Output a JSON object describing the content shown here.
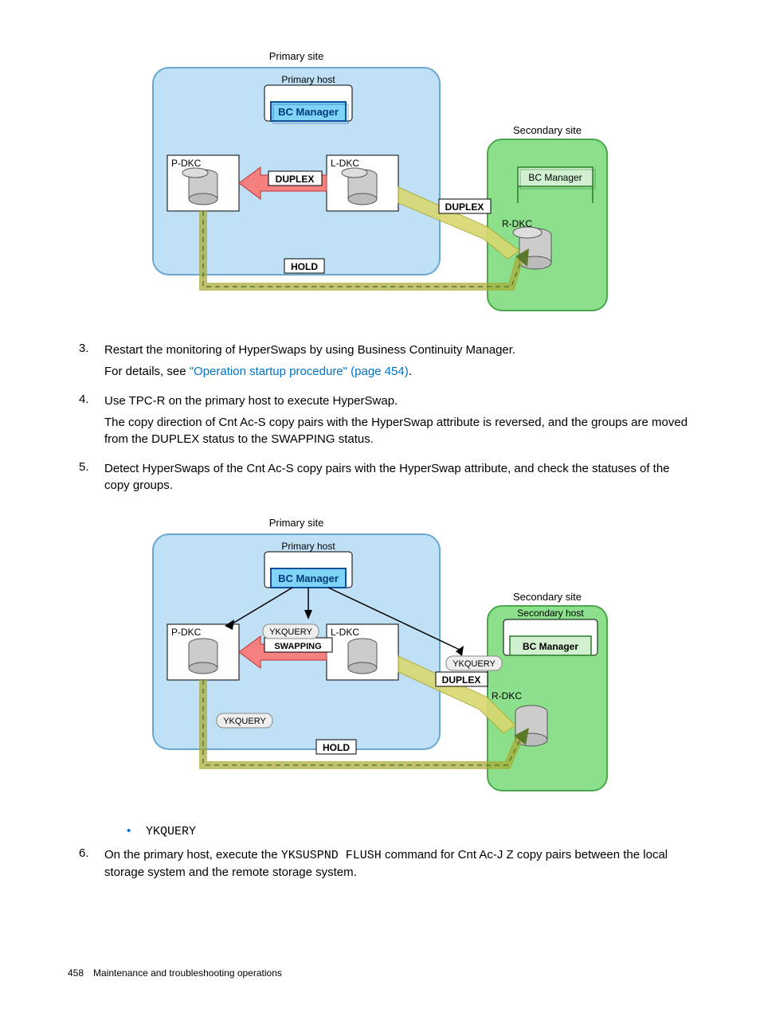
{
  "diagram1": {
    "primary_site": "Primary site",
    "primary_host": "Primary host",
    "bc_manager": "BC Manager",
    "secondary_site": "Secondary site",
    "bc_manager2": "BC Manager",
    "p_dkc": "P-DKC",
    "l_dkc": "L-DKC",
    "r_dkc": "R-DKC",
    "duplex1": "DUPLEX",
    "duplex2": "DUPLEX",
    "hold": "HOLD"
  },
  "steps": {
    "s3": {
      "num": "3.",
      "p1": "Restart the monitoring of HyperSwaps by using Business Continuity Manager.",
      "p2a": "For details, see ",
      "link": "\"Operation startup procedure\" (page 454)",
      "p2b": "."
    },
    "s4": {
      "num": "4.",
      "p1": "Use TPC-R on the primary host to execute HyperSwap.",
      "p2": "The copy direction of Cnt Ac-S copy pairs with the HyperSwap attribute is reversed, and the groups are moved from the DUPLEX status to the SWAPPING status."
    },
    "s5": {
      "num": "5.",
      "p1": "Detect HyperSwaps of the Cnt Ac-S copy pairs with the HyperSwap attribute, and check the statuses of the copy groups."
    },
    "s6": {
      "num": "6.",
      "p1a": "On the primary host, execute the ",
      "cmd": "YKSUSPND FLUSH",
      "p1b": " command for Cnt Ac-J Z copy pairs between the local storage system and the remote storage system."
    }
  },
  "diagram2": {
    "primary_site": "Primary site",
    "primary_host": "Primary host",
    "bc_manager": "BC Manager",
    "secondary_site": "Secondary site",
    "secondary_host": "Secondary host",
    "bc_manager2": "BC Manager",
    "p_dkc": "P-DKC",
    "l_dkc": "L-DKC",
    "r_dkc": "R-DKC",
    "ykquery1": "YKQUERY",
    "ykquery2": "YKQUERY",
    "ykquery3": "YKQUERY",
    "swapping": "SWAPPING",
    "duplex": "DUPLEX",
    "hold": "HOLD"
  },
  "bullet": "YKQUERY",
  "footer": {
    "page": "458",
    "title": "Maintenance and troubleshooting operations"
  }
}
